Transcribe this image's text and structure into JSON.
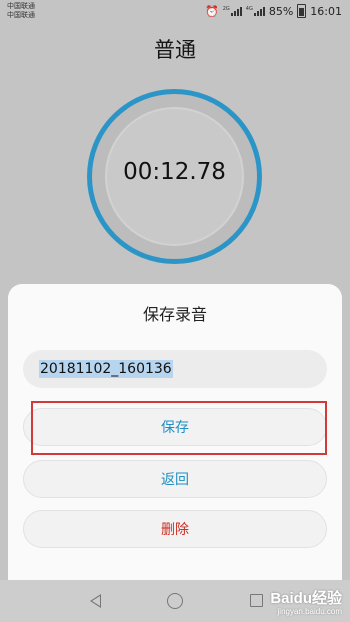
{
  "status_bar": {
    "carrier_1": "中国联通",
    "carrier_2": "中国联通",
    "network_tag_1": "2G",
    "network_tag_2": "4G",
    "battery": "85%",
    "time": "16:01",
    "icons": [
      "alarm-clock-icon",
      "signal-icon",
      "battery-icon"
    ]
  },
  "recorder": {
    "mode_title": "普通",
    "timer": "00:12.78",
    "accent_color": "#2c95c8"
  },
  "save_dialog": {
    "title": "保存录音",
    "file_name": "20181102_160136",
    "save_label": "保存",
    "back_label": "返回",
    "delete_label": "删除",
    "save_color": "#1f8fc4",
    "delete_color": "#cc2c22"
  },
  "watermark": {
    "brand": "Baidu经验",
    "url": "jingyan.baidu.com"
  }
}
